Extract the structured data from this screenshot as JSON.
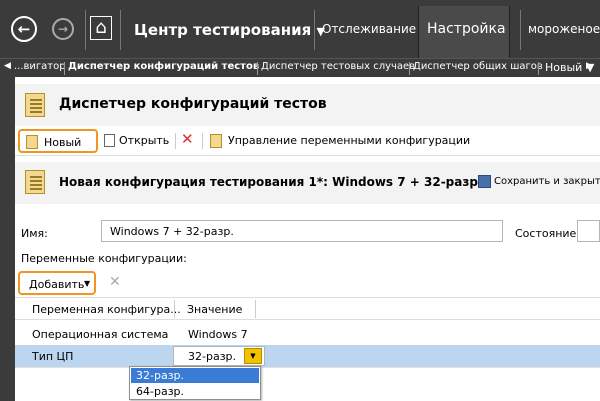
{
  "topnav": {
    "back_glyph": "←",
    "forward_glyph": "→",
    "home_glyph": "⌂",
    "center": "Центр тестирования",
    "tab_tracking": "Отслеживание",
    "tab_settings": "Настройка",
    "project": "мороженое"
  },
  "subnav": {
    "items": [
      "...вигатор",
      "Диспетчер конфигураций тестов",
      "Диспетчер тестовых случаев",
      "Диспетчер общих шагов",
      "Новый"
    ]
  },
  "manager": {
    "title": "Диспетчер конфигураций тестов",
    "toolbar": {
      "new": "Новый",
      "open": "Открыть",
      "manage_vars": "Управление переменными конфигурации"
    }
  },
  "config": {
    "title": "Новая конфигурация тестирования 1*: Windows 7 + 32-разр.",
    "save_close": "Сохранить и закрыть",
    "name_label": "Имя:",
    "name_value": "Windows 7 + 32-разр.",
    "state_label": "Состояние:",
    "vars_label": "Переменные конфигурации:",
    "add_button": "Добавить",
    "columns": [
      "Переменная конфигура...",
      "Значение"
    ],
    "rows": [
      {
        "variable": "Операционная система",
        "value": "Windows 7"
      },
      {
        "variable": "Тип ЦП",
        "value": "32-разр."
      }
    ],
    "dropdown_options": [
      "32-разр.",
      "64-разр."
    ]
  },
  "colors": {
    "nav_bg": "#3b3b3b",
    "highlight_orange": "#f0961e",
    "selected_row": "#bcd6f0",
    "selected_option": "#3a7bd5"
  }
}
